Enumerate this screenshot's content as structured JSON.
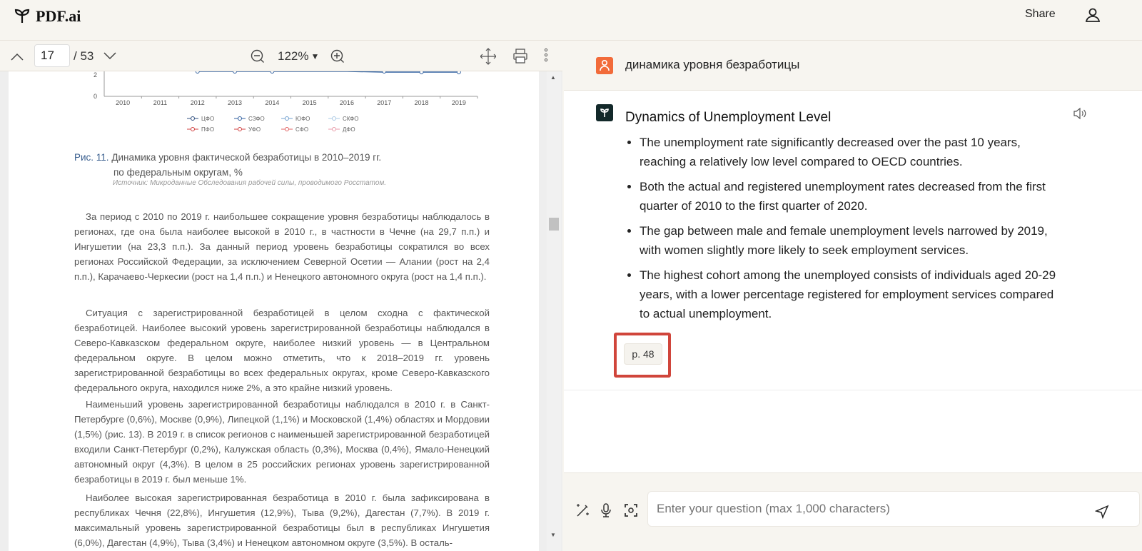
{
  "app": {
    "name": "PDF.ai",
    "share_label": "Share"
  },
  "toolbar": {
    "current_page": "17",
    "total_pages": "/ 53",
    "zoom": "122%"
  },
  "chart": {
    "y_ticks": [
      "2",
      "0"
    ],
    "x_ticks": [
      "2010",
      "2011",
      "2012",
      "2013",
      "2014",
      "2015",
      "2016",
      "2017",
      "2018",
      "2019"
    ],
    "legend": [
      "ЦФО",
      "СЗФО",
      "ЮФО",
      "СКФО",
      "ПФО",
      "УФО",
      "СФО",
      "ДФО"
    ],
    "legend_colors": [
      "#2f4f7f",
      "#2f5f9f",
      "#6f9fcf",
      "#a9c9e4",
      "#d04040",
      "#d04040",
      "#e06060",
      "#e89aa8"
    ]
  },
  "figure": {
    "label": "Рис. 11.",
    "title_line1": "Динамика уровня фактической безработицы в 2010–2019 гг.",
    "title_line2": "по федеральным округам, %",
    "source": "Источник: Микроданные Обследования рабочей силы, проводимого Росстатом."
  },
  "paragraphs": [
    "За период с 2010 по 2019 г. наибольшее сокращение уровня безработицы наблюдалось в регионах, где она была наиболее высокой в 2010 г., в частности в Чечне (на 29,7 п.п.) и Ингушетии (на 23,3 п.п.). За данный период уровень безработицы сократился во всех регионах Российской Федерации, за исключением Северной Осетии — Алании (рост на 2,4 п.п.), Карачаево-Черкесии (рост на 1,4 п.п.) и Ненецкого автономного округа (рост на 1,4 п.п.).",
    "Ситуация с зарегистрированной безработицей в целом сходна с фактической безработицей. Наиболее высокий уровень зарегистрированной безработицы наблюдался в Северо-Кавказском федеральном округе, наиболее низкий уровень — в Центральном федеральном округе. В целом можно отметить, что к 2018–2019 гг. уровень зарегистрированной безработицы во всех федеральных округах, кроме Северо-Кавказского федерального округа, находился ниже 2%, а это крайне низкий уровень.",
    "Наименьший уровень зарегистрированной безработицы наблюдался в 2010 г. в Санкт-Петербурге (0,6%), Москве (0,9%), Липецкой (1,1%) и Московской (1,4%) областях и Мордовии (1,5%) (рис. 13). В 2019 г. в список регионов с наименьшей зарегистрированной безработицей входили Санкт-Петербург (0,2%), Калужская область (0,3%), Москва (0,4%), Ямало-Ненецкий автономный округ (4,3%). В целом в 25 российских регионах уровень зарегистрированной безработицы в 2019 г. был меньше 1%.",
    "Наиболее высокая зарегистрированная безработица в 2010 г. была зафиксирована в республиках Чечня (22,8%), Ингушетия (12,9%), Тыва (9,2%), Дагестан (7,7%). В 2019 г. максимальный уровень зарегистрированной безработицы был в республиках Ингушетия (6,0%), Дагестан (4,9%), Тыва (3,4%) и Ненецком автономном округе (3,5%). В осталь-"
  ],
  "chat": {
    "question": "динамика уровня безработицы",
    "answer_title": "Dynamics of Unemployment Level",
    "bullets": [
      "The unemployment rate significantly decreased over the past 10 years, reaching a relatively low level compared to OECD countries.",
      "Both the actual and registered unemployment rates decreased from the first quarter of 2010 to the first quarter of 2020.",
      "The gap between male and female unemployment levels narrowed by 2019, with women slightly more likely to seek employment services.",
      "The highest cohort among the unemployed consists of individuals aged 20-29 years, with a lower percentage registered for employment services compared to actual unemployment."
    ],
    "citation": "p. 48",
    "input_placeholder": "Enter your question (max 1,000 characters)"
  },
  "colors": {
    "accent_user": "#f26b3a",
    "highlight": "#d0453b",
    "bot_avatar": "#13292a"
  }
}
